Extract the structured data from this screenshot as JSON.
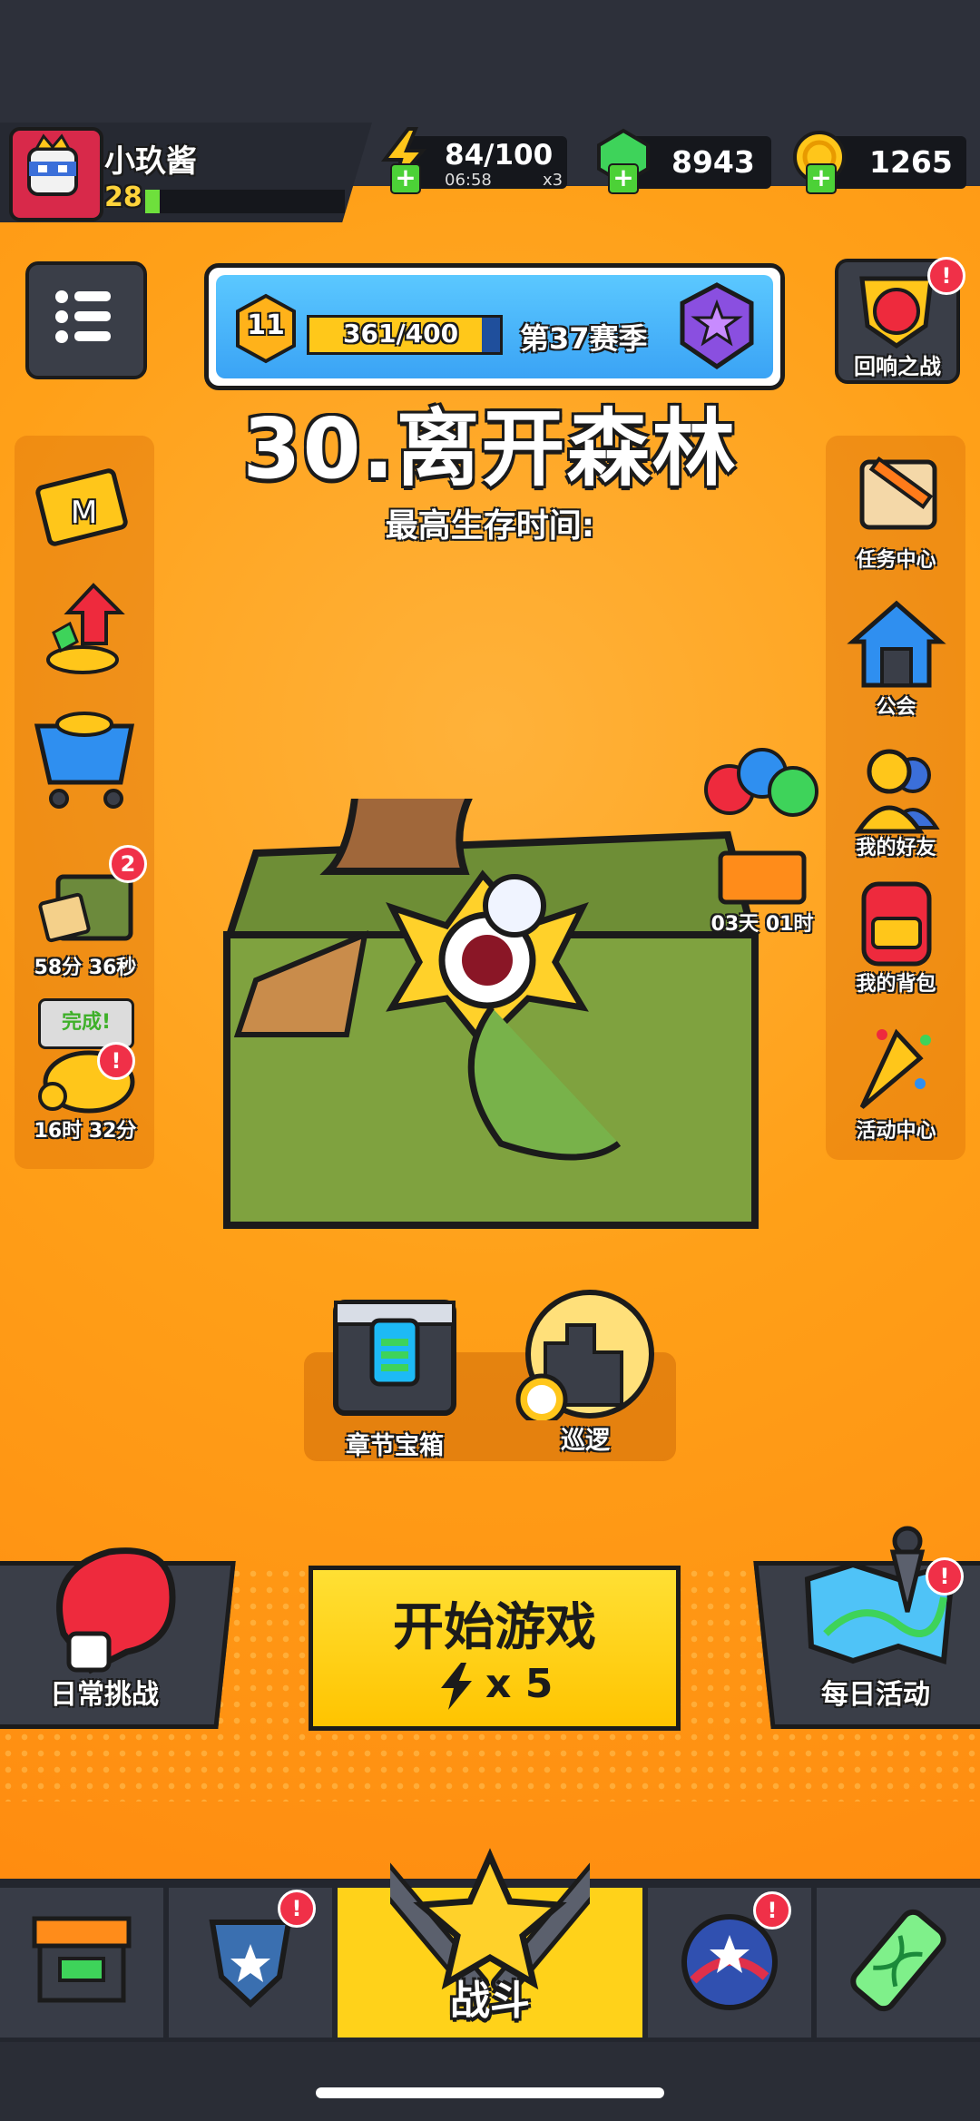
{
  "player": {
    "name": "小玖酱",
    "level": "28"
  },
  "resources": {
    "energy": "84/100",
    "energy_timer": "06:58",
    "energy_multiplier": "x3",
    "gems": "8943",
    "coins": "1265"
  },
  "season": {
    "level": "11",
    "progress": "361/400",
    "progress_fraction": 0.9025,
    "label": "第37赛季"
  },
  "chapter": {
    "title": "30.离开森林",
    "subtitle": "最高生存时间:"
  },
  "left_sidebar": {
    "pass_label": "M",
    "timed_chest_badge": "2",
    "timed_chest_time": "58分 36秒",
    "piggy_bubble": "完成!",
    "piggy_time": "16时 32分"
  },
  "right_sidebar": {
    "echo_battle": "回响之战",
    "tasks": "任务中心",
    "guild": "公会",
    "friends": "我的好友",
    "backpack": "我的背包",
    "events": "活动中心"
  },
  "balloon_gift_time": "03天 01时",
  "chest_row": {
    "chapter_chest": "章节宝箱",
    "patrol": "巡逻"
  },
  "actions": {
    "daily_challenge": "日常挑战",
    "start_game": "开始游戏",
    "start_cost": "x 5",
    "daily_events": "每日活动"
  },
  "nav": {
    "battle": "战斗"
  },
  "colors": {
    "orange_bg": "#ffa018",
    "start_yellow": "#ffd21a",
    "alert_red": "#f03048"
  }
}
